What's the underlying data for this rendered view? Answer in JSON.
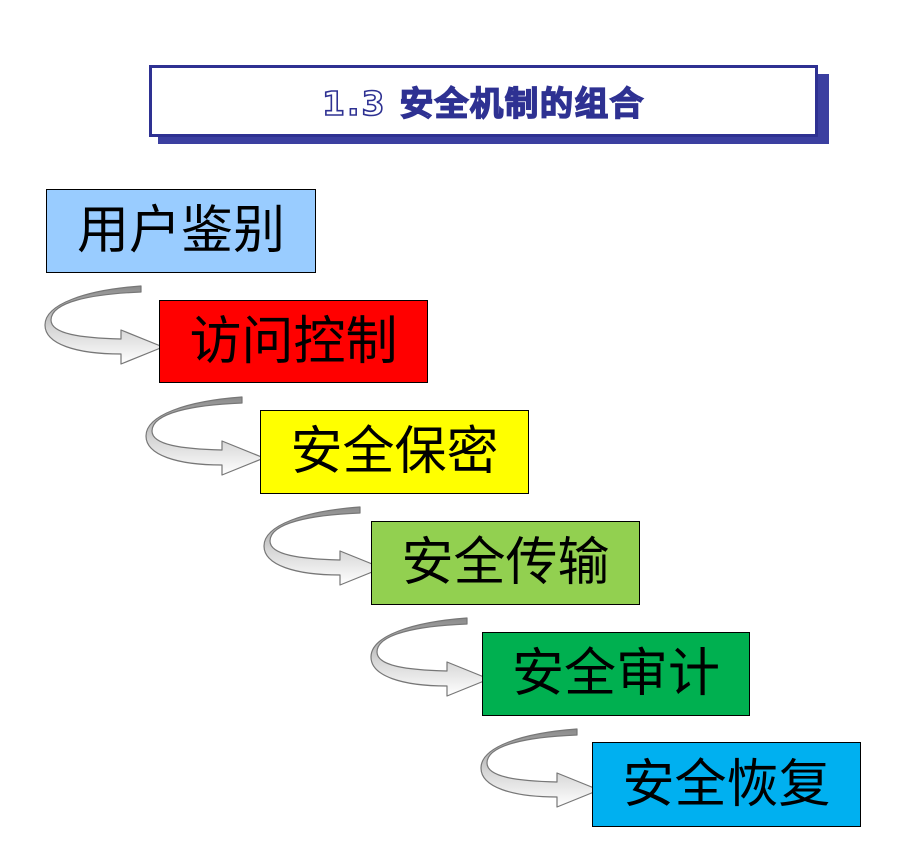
{
  "title": "1.3 安全机制的组合",
  "steps": [
    {
      "label": "用户鉴别",
      "color": "#99ccff"
    },
    {
      "label": "访问控制",
      "color": "#ff0000"
    },
    {
      "label": "安全保密",
      "color": "#ffff00"
    },
    {
      "label": "安全传输",
      "color": "#92d050"
    },
    {
      "label": "安全审计",
      "color": "#00b050"
    },
    {
      "label": "安全恢复",
      "color": "#00b0f0"
    }
  ]
}
